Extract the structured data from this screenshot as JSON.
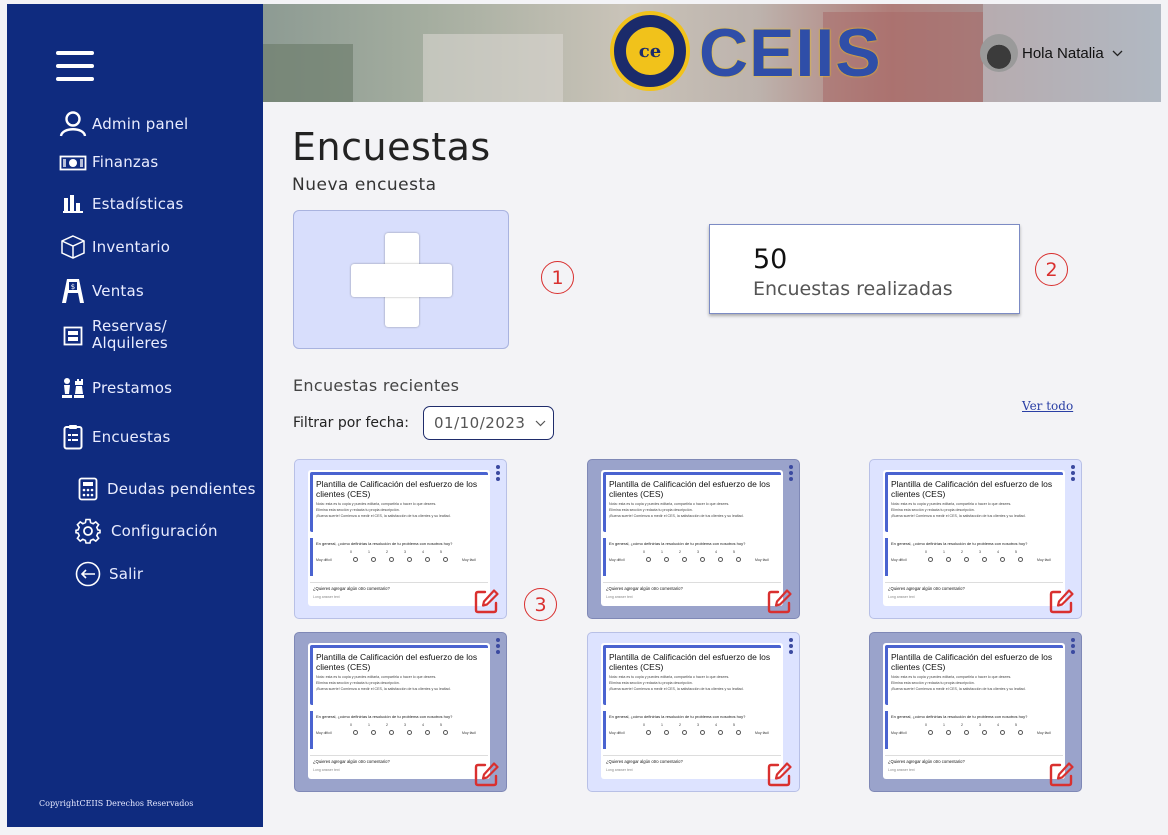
{
  "sidebar": {
    "items": [
      {
        "label": "Admin panel",
        "icon": "user-icon"
      },
      {
        "label": "Finanzas",
        "icon": "money-icon"
      },
      {
        "label": "Estadísticas",
        "icon": "bar-chart-icon"
      },
      {
        "label": "Inventario",
        "icon": "box-icon"
      },
      {
        "label": "Ventas",
        "icon": "sign-icon"
      },
      {
        "label": "Reservas/",
        "label2": "Alquileres",
        "icon": "calendar-icon"
      },
      {
        "label": "Prestamos",
        "icon": "chess-icon"
      },
      {
        "label": "Encuestas",
        "icon": "clipboard-icon"
      },
      {
        "label": "Deudas pendientes",
        "icon": "calculator-icon"
      },
      {
        "label": "Configuración",
        "icon": "gear-icon"
      },
      {
        "label": "Salir",
        "icon": "logout-icon"
      }
    ],
    "copyright": "CopyrightCEIIS Derechos Reservados"
  },
  "header": {
    "logo_text": "CEIIS",
    "logo_badge": "ce",
    "greeting": "Hola Natalia"
  },
  "main": {
    "title": "Encuestas",
    "new_survey_label": "Nueva encuesta",
    "stat": {
      "value": "50",
      "label": "Encuestas realizadas"
    },
    "callouts": [
      "1",
      "2",
      "3"
    ],
    "recent_title": "Encuestas recientes",
    "view_all": "Ver todo",
    "filter_label": "Filtrar por fecha:",
    "filter_value": "01/10/2023"
  },
  "card": {
    "title": "Plantilla de Calificación del esfuerzo de los clientes (CES)",
    "line1": "Nota: esta es tu copia y puedes editarla, compartirla o hacer lo que desees.",
    "line2": "Elimina esta sección y redacta tu propia descripción.",
    "line3": "¡Buena suerte! Comienza a medir el CES, la satisfacción de tus clientes y su lealtad.",
    "question": "En general, ¿cómo definirías la resolución de tu problema con nosotros hoy?",
    "scale": [
      "0",
      "1",
      "2",
      "3",
      "4",
      "5"
    ],
    "low": "Muy difícil",
    "high": "Muy fácil",
    "comment_q": "¿Quieres agregar algún otro comentario?",
    "comment_a": "Long answer text"
  },
  "colors": {
    "sidebar": "#0f2b7f",
    "card_light": "#dde3ff",
    "card_dark": "#9aa3cb",
    "accent_red": "#d9302f"
  }
}
